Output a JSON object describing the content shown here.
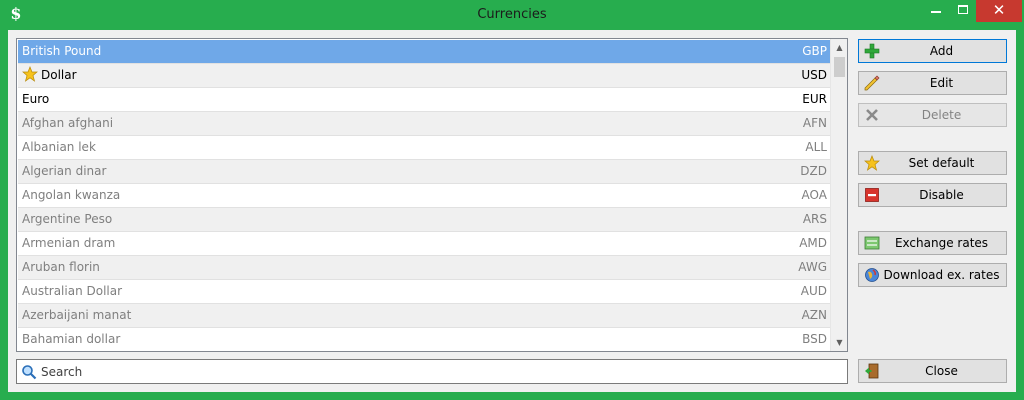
{
  "window": {
    "title": "Currencies",
    "app_icon": "dollar-icon",
    "controls": {
      "minimize": "minimize-icon",
      "maximize": "maximize-icon",
      "close": "✕"
    }
  },
  "colors": {
    "frame": "#27ad4e",
    "selection": "#6fa8e8",
    "disabled_text": "#7f7f7f",
    "close_button": "#c7392f"
  },
  "currencies": [
    {
      "name": "British Pound",
      "code": "GBP",
      "state": "selected",
      "default": false
    },
    {
      "name": "Dollar",
      "code": "USD",
      "state": "enabled",
      "default": true
    },
    {
      "name": "Euro",
      "code": "EUR",
      "state": "enabled",
      "default": false
    },
    {
      "name": "Afghan afghani",
      "code": "AFN",
      "state": "disabled",
      "default": false
    },
    {
      "name": "Albanian lek",
      "code": "ALL",
      "state": "disabled",
      "default": false
    },
    {
      "name": "Algerian dinar",
      "code": "DZD",
      "state": "disabled",
      "default": false
    },
    {
      "name": "Angolan kwanza",
      "code": "AOA",
      "state": "disabled",
      "default": false
    },
    {
      "name": "Argentine Peso",
      "code": "ARS",
      "state": "disabled",
      "default": false
    },
    {
      "name": "Armenian dram",
      "code": "AMD",
      "state": "disabled",
      "default": false
    },
    {
      "name": "Aruban florin",
      "code": "AWG",
      "state": "disabled",
      "default": false
    },
    {
      "name": "Australian Dollar",
      "code": "AUD",
      "state": "disabled",
      "default": false
    },
    {
      "name": "Azerbaijani manat",
      "code": "AZN",
      "state": "disabled",
      "default": false
    },
    {
      "name": "Bahamian dollar",
      "code": "BSD",
      "state": "disabled",
      "default": false
    }
  ],
  "buttons": {
    "add": {
      "label": "Add",
      "icon": "plus-icon"
    },
    "edit": {
      "label": "Edit",
      "icon": "pencil-icon"
    },
    "delete": {
      "label": "Delete",
      "icon": "x-icon"
    },
    "set_default": {
      "label": "Set default",
      "icon": "star-icon"
    },
    "disable": {
      "label": "Disable",
      "icon": "minus-icon"
    },
    "exchange_rates": {
      "label": "Exchange rates",
      "icon": "exchange-icon"
    },
    "download_rates": {
      "label": "Download ex. rates",
      "icon": "globe-icon"
    },
    "close": {
      "label": "Close",
      "icon": "exit-door-icon"
    }
  },
  "search": {
    "placeholder": "Search",
    "value": "",
    "icon": "magnifier-icon"
  }
}
